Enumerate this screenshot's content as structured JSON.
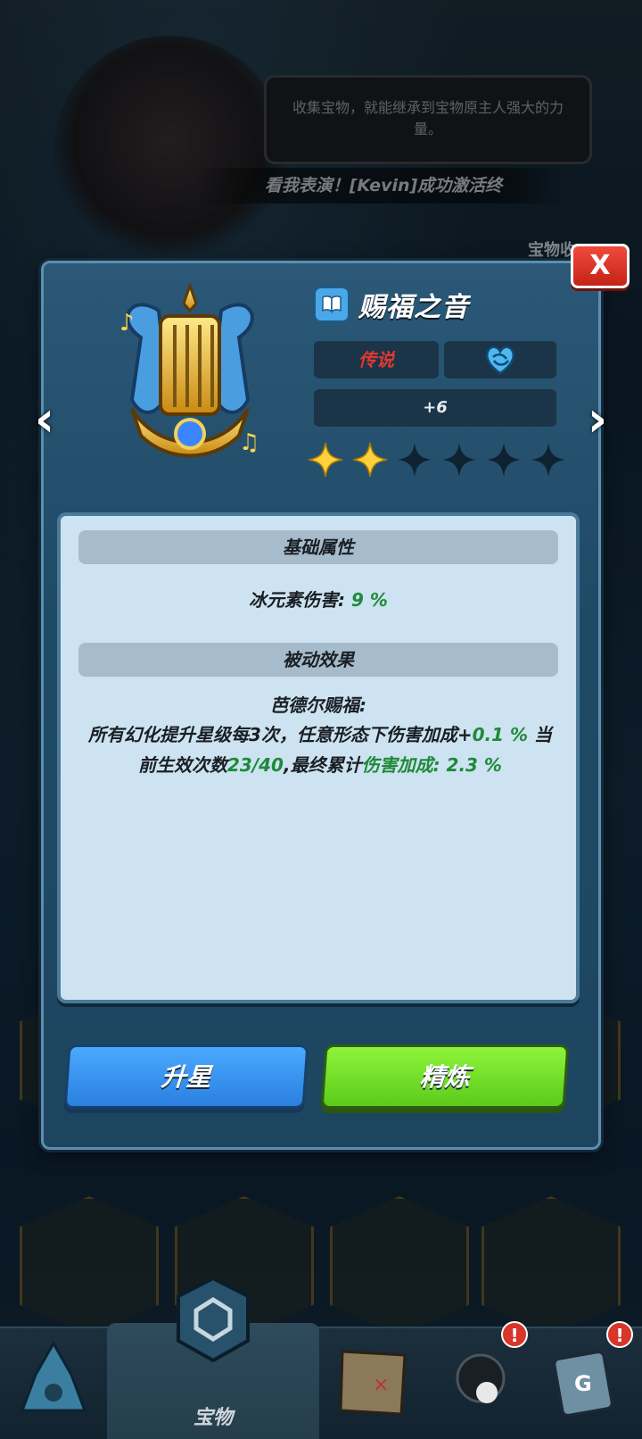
{
  "background": {
    "hint_text": "收集宝物，就能继承到宝物原主人强大的力量。",
    "ticker_text": "看我表演！[Kevin]成功激活终",
    "chest_label": "宝物收"
  },
  "modal": {
    "close_label": "X",
    "prev_arrow": "‹",
    "next_arrow": "›",
    "treasure_name": "赐福之音",
    "rarity": "传说",
    "level": "+6",
    "stars_filled": 2,
    "stars_total": 6,
    "base_section_title": "基础属性",
    "stat_label": "冰元素伤害: ",
    "stat_value": "9 %",
    "passive_section_title": "被动效果",
    "passive_name": "芭德尔赐福:",
    "passive_desc_1": "所有幻化提升星级每3次，任意形态下伤害加成+",
    "passive_value_1": "0.1 %",
    "passive_desc_2": " 当前生效次数",
    "passive_count": "23/40",
    "passive_desc_3": ",最终累计",
    "passive_total": "伤害加成: 2.3 %",
    "upstar_label": "升星",
    "refine_label": "精炼"
  },
  "bottom_nav": {
    "active_label": "宝物",
    "badge_1": "!",
    "badge_2": "!"
  },
  "colors": {
    "rarity": "#e0392f",
    "upstar_button": "#3a93f0",
    "refine_button": "#76e02a",
    "highlight_green": "#1f8a3a"
  }
}
